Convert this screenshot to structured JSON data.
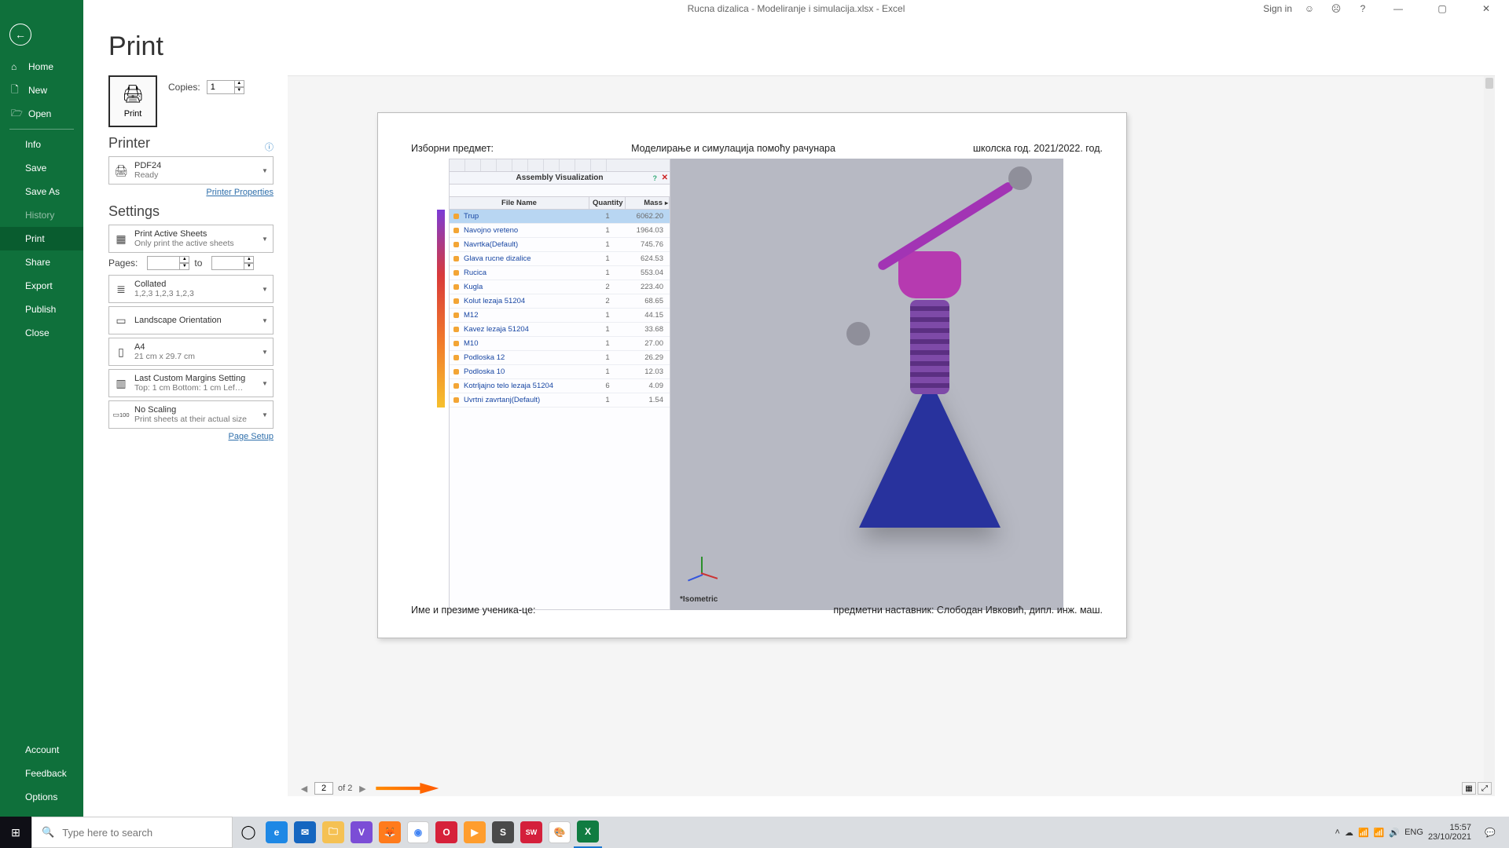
{
  "titlebar": {
    "title": "Rucna dizalica - Modeliranje i simulacija.xlsx  -  Excel",
    "signin": "Sign in"
  },
  "sidebar": {
    "back_aria": "Back",
    "top": [
      {
        "icon": "⌂",
        "label": "Home"
      },
      {
        "icon": "🗋",
        "label": "New"
      },
      {
        "icon": "🗁",
        "label": "Open"
      }
    ],
    "mid": [
      {
        "label": "Info"
      },
      {
        "label": "Save"
      },
      {
        "label": "Save As"
      },
      {
        "label": "History",
        "muted": true
      },
      {
        "label": "Print",
        "active": true
      },
      {
        "label": "Share"
      },
      {
        "label": "Export"
      },
      {
        "label": "Publish"
      },
      {
        "label": "Close"
      }
    ],
    "bottom": [
      {
        "label": "Account"
      },
      {
        "label": "Feedback"
      },
      {
        "label": "Options"
      }
    ]
  },
  "print": {
    "heading": "Print",
    "button": "Print",
    "copies_label": "Copies:",
    "copies_value": "1"
  },
  "printer": {
    "heading": "Printer",
    "name": "PDF24",
    "status": "Ready",
    "props_link": "Printer Properties"
  },
  "settings": {
    "heading": "Settings",
    "active_sheets": {
      "l1": "Print Active Sheets",
      "l2": "Only print the active sheets"
    },
    "pages_label": "Pages:",
    "pages_to": "to",
    "collated": {
      "l1": "Collated",
      "l2": "1,2,3    1,2,3    1,2,3"
    },
    "orientation": {
      "l1": "Landscape Orientation"
    },
    "paper": {
      "l1": "A4",
      "l2": "21 cm x 29.7 cm"
    },
    "margins": {
      "l1": "Last Custom Margins Setting",
      "l2": "Top: 1 cm Bottom: 1 cm Lef…"
    },
    "scaling": {
      "l1": "No Scaling",
      "l2": "Print sheets at their actual size"
    },
    "page_setup": "Page Setup"
  },
  "preview": {
    "hdr_left": "Изборни предмет:",
    "hdr_mid": "Моделирање и симулација помоћу рачунара",
    "hdr_right": "школска год. 2021/2022. год.",
    "ftr_left": "Име и презиме ученика-це:",
    "ftr_right": "предметни наставник: Слободан Ивковић, дипл. инж. маш.",
    "asm_title": "Assembly Visualization",
    "iso": "*Isometric",
    "nav_page": "2",
    "nav_of": "of 2",
    "cols": {
      "c1": "File Name",
      "c2": "Quantity",
      "c3": "Mass"
    }
  },
  "chart_data": {
    "type": "table",
    "title": "Assembly Visualization",
    "columns": [
      "File Name",
      "Quantity",
      "Mass"
    ],
    "rows": [
      {
        "name": "Trup",
        "qty": 1,
        "mass": 6062.2,
        "selected": true
      },
      {
        "name": "Navojno vreteno",
        "qty": 1,
        "mass": 1964.03
      },
      {
        "name": "Navrtka(Default)",
        "qty": 1,
        "mass": 745.76
      },
      {
        "name": "Glava rucne dizalice",
        "qty": 1,
        "mass": 624.53
      },
      {
        "name": "Rucica",
        "qty": 1,
        "mass": 553.04
      },
      {
        "name": "Kugla",
        "qty": 2,
        "mass": 223.4
      },
      {
        "name": "Kolut lezaja 51204",
        "qty": 2,
        "mass": 68.65
      },
      {
        "name": "M12",
        "qty": 1,
        "mass": 44.15
      },
      {
        "name": "Kavez lezaja 51204",
        "qty": 1,
        "mass": 33.68
      },
      {
        "name": "M10",
        "qty": 1,
        "mass": 27.0
      },
      {
        "name": "Podloska 12",
        "qty": 1,
        "mass": 26.29
      },
      {
        "name": "Podloska 10",
        "qty": 1,
        "mass": 12.03
      },
      {
        "name": "Kotrljajno telo lezaja 51204",
        "qty": 6,
        "mass": 4.09
      },
      {
        "name": "Uvrtni zavrtanj(Default)",
        "qty": 1,
        "mass": 1.54
      }
    ]
  },
  "taskbar": {
    "search_placeholder": "Type here to search",
    "lang": "ENG",
    "time": "15:57",
    "date": "23/10/2021"
  }
}
